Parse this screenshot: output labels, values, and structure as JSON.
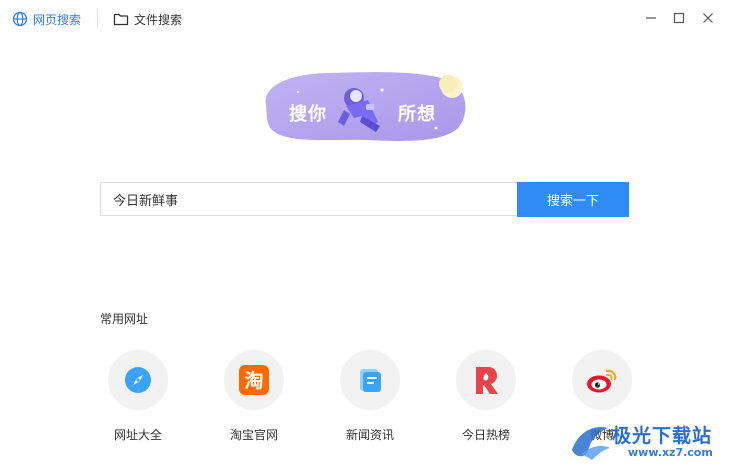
{
  "topbar": {
    "tab_web": "网页搜索",
    "tab_file": "文件搜索"
  },
  "banner": {
    "left_text": "搜你",
    "right_text": "所想"
  },
  "search": {
    "value": "今日新鲜事",
    "button_label": "搜索一下"
  },
  "common_sites": {
    "title": "常用网址",
    "items": [
      {
        "label": "网址大全",
        "icon": "compass-icon"
      },
      {
        "label": "淘宝官网",
        "icon": "taobao-icon"
      },
      {
        "label": "新闻资讯",
        "icon": "news-icon"
      },
      {
        "label": "今日热榜",
        "icon": "hot-list-icon"
      },
      {
        "label": "微博",
        "icon": "weibo-icon"
      }
    ]
  },
  "watermark": {
    "text": "极光下载站",
    "url": "www.xz7.com"
  },
  "colors": {
    "accent": "#2f8cf5",
    "banner": "#b7a6ee",
    "taobao": "#ff6a00",
    "hot": "#e8434b"
  }
}
